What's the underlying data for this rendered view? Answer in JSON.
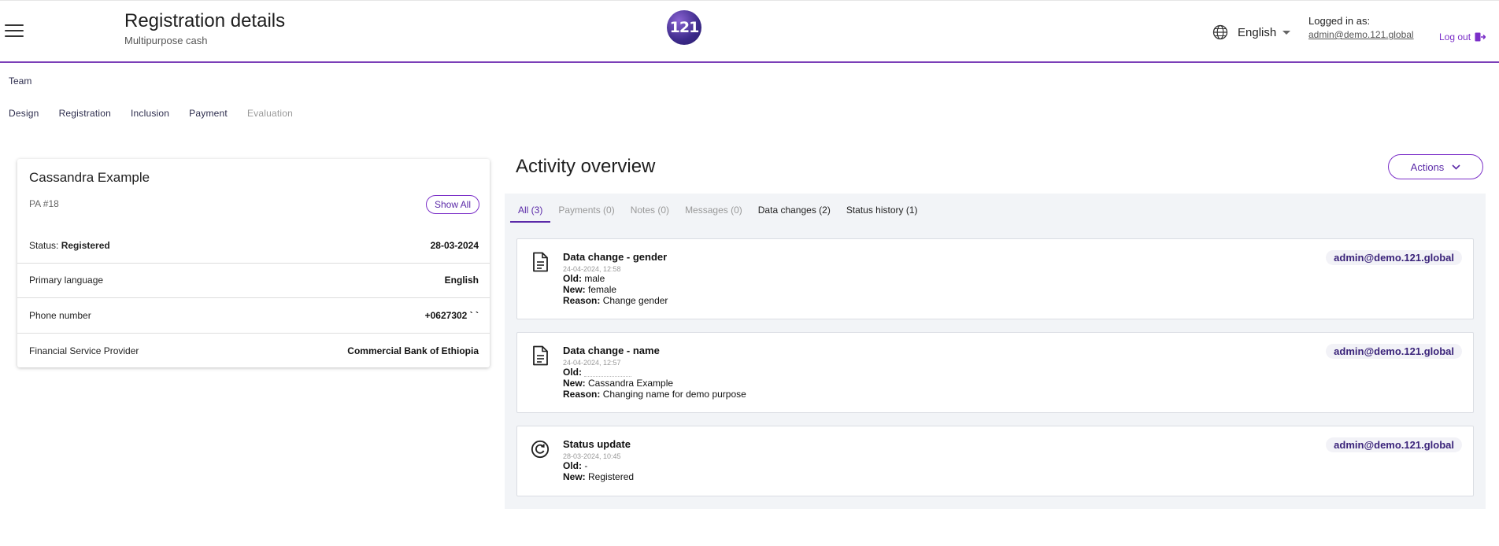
{
  "header": {
    "title": "Registration details",
    "subtitle": "Multipurpose cash",
    "logo_text": "121",
    "language": "English",
    "logged_in_label": "Logged in as:",
    "user_email": "admin@demo.121.global",
    "logout_label": "Log out",
    "accent_color": "#7b3fb8"
  },
  "nav": {
    "team": "Team",
    "items": [
      {
        "label": "Design"
      },
      {
        "label": "Registration"
      },
      {
        "label": "Inclusion"
      },
      {
        "label": "Payment"
      },
      {
        "label": "Evaluation"
      }
    ]
  },
  "profile": {
    "name": "Cassandra Example",
    "pa_id": "PA #18",
    "show_all_label": "Show All",
    "status_label": "Status:",
    "status_value": "Registered",
    "status_date": "28-03-2024",
    "rows": [
      {
        "label": "Primary language",
        "value": "English"
      },
      {
        "label": "Phone number",
        "value": "+0627302 ` `"
      },
      {
        "label": "Financial Service Provider",
        "value": "Commercial Bank of Ethiopia"
      }
    ]
  },
  "activity": {
    "title": "Activity overview",
    "actions_label": "Actions",
    "tabs": [
      {
        "label": "All (3)"
      },
      {
        "label": "Payments (0)"
      },
      {
        "label": "Notes (0)"
      },
      {
        "label": "Messages (0)"
      },
      {
        "label": "Data changes (2)"
      },
      {
        "label": "Status history (1)"
      }
    ],
    "entries": [
      {
        "icon": "document-icon",
        "title": "Data change - gender",
        "date": "24-04-2024, 12:58",
        "old_label": "Old:",
        "old_value": "male",
        "new_label": "New:",
        "new_value": "female",
        "reason_label": "Reason:",
        "reason_value": "Change gender",
        "user": "admin@demo.121.global"
      },
      {
        "icon": "document-icon",
        "title": "Data change - name",
        "date": "24-04-2024, 12:57",
        "old_label": "Old:",
        "old_value": "",
        "new_label": "New:",
        "new_value": "Cassandra Example",
        "reason_label": "Reason:",
        "reason_value": "Changing name for demo purpose",
        "user": "admin@demo.121.global"
      },
      {
        "icon": "refresh-icon",
        "title": "Status update",
        "date": "28-03-2024, 10:45",
        "old_label": "Old:",
        "old_value": "-",
        "new_label": "New:",
        "new_value": "Registered",
        "user": "admin@demo.121.global"
      }
    ]
  }
}
